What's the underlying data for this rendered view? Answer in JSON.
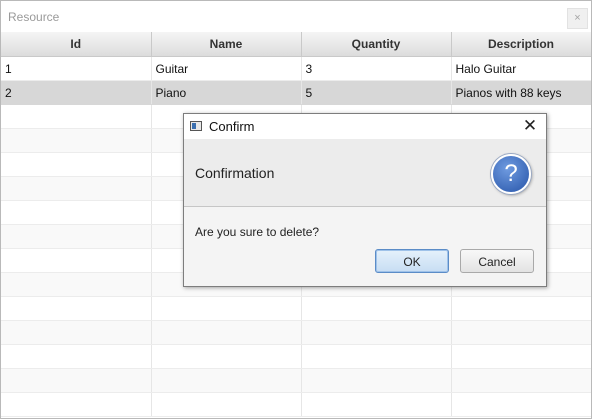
{
  "window": {
    "title": "Resource",
    "close_glyph": "×"
  },
  "table": {
    "columns": [
      "Id",
      "Name",
      "Quantity",
      "Description"
    ],
    "rows": [
      [
        "1",
        "Guitar",
        "3",
        "Halo Guitar"
      ],
      [
        "2",
        "Piano",
        "5",
        "Pianos with 88 keys"
      ]
    ],
    "selected_row": 2
  },
  "dialog": {
    "title": "Confirm",
    "close_glyph": "✕",
    "header": "Confirmation",
    "icon": "question-icon",
    "icon_glyph": "?",
    "content": "Are you sure to delete?",
    "ok_label": "OK",
    "cancel_label": "Cancel"
  },
  "colors": {
    "selected_row": "#d7d7d7",
    "question_icon": "#2f5fb3",
    "ok_button_border": "#5b8cc7"
  }
}
